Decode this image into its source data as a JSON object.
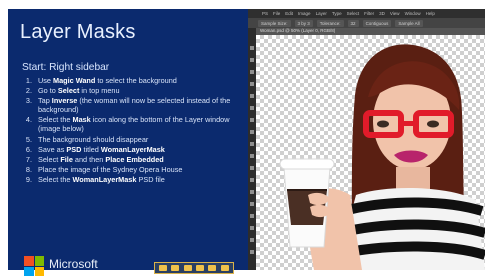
{
  "slide": {
    "title": "Layer Masks",
    "start": "Start: Right sidebar",
    "steps": [
      {
        "num": "1.",
        "parts": [
          "Use ",
          "Magic Wand",
          " to select the background"
        ]
      },
      {
        "num": "2.",
        "parts": [
          "Go to ",
          "Select",
          " in top menu"
        ]
      },
      {
        "num": "3.",
        "parts": [
          "Tap ",
          "Inverse",
          " (the woman will now be selected instead of the background)"
        ]
      },
      {
        "num": "4.",
        "parts": [
          "Select the ",
          "Mask",
          " icon along the bottom of the Layer window (image below)"
        ]
      },
      {
        "num": "5.",
        "parts": [
          "The background should disappear",
          "",
          ""
        ]
      },
      {
        "num": "6.",
        "parts": [
          "Save as ",
          "PSD",
          " titled "
        ]
      },
      {
        "num": "7.",
        "parts": [
          "Select ",
          "File",
          " and then "
        ]
      },
      {
        "num": "8.",
        "parts": [
          "Place the image of the Sydney Opera House",
          "",
          ""
        ]
      },
      {
        "num": "9.",
        "parts": [
          "Select the ",
          "WomanLayerMask",
          " PSD file"
        ]
      }
    ],
    "step6_extra": "WomanLayerMask",
    "step7_extra": "Place Embedded"
  },
  "brand": {
    "name": "Microsoft"
  },
  "photoshop": {
    "menu": [
      "PS",
      "File",
      "Edit",
      "Image",
      "Layer",
      "Type",
      "Select",
      "Filter",
      "3D",
      "View",
      "Window",
      "Help"
    ],
    "options": [
      "Sample Size:",
      "3 by 3",
      "Tolerance:",
      "32",
      "Contiguous",
      "Sample All"
    ],
    "tab": "Woman.psd @ 50% (Layer 0, RGB/8)"
  },
  "colors": {
    "panel_bg": "#0b2a6e",
    "accent_yellow": "#f0c24a"
  },
  "icons": [
    "microsoft-logo-icon",
    "play-icon",
    "woman-photo-icon"
  ]
}
